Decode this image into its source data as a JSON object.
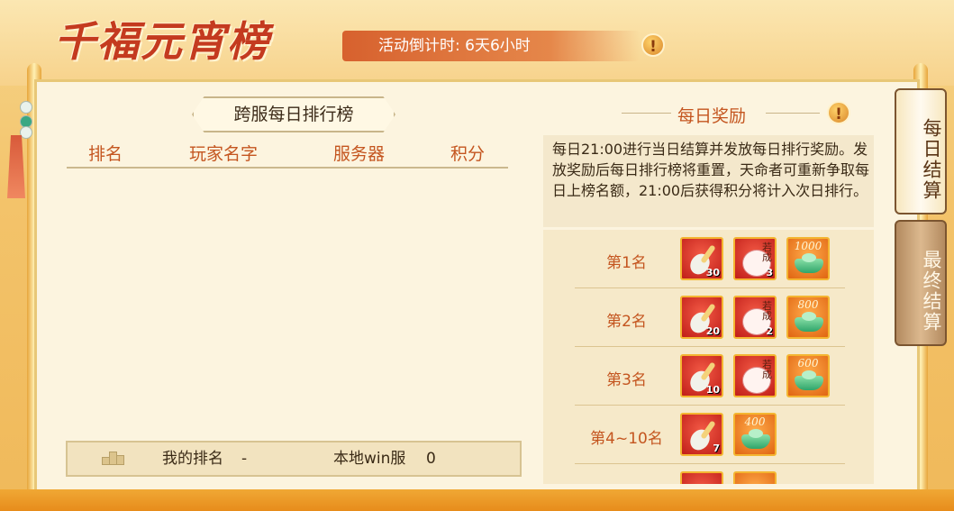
{
  "header": {
    "title": "千福元宵榜",
    "countdown": "活动倒计时: 6天6小时",
    "info_symbol": "!"
  },
  "leaderboard": {
    "tab_title": "跨服每日排行榜",
    "columns": [
      "排名",
      "玩家名字",
      "服务器",
      "积分"
    ],
    "my_rank_label": "我的排名",
    "my_rank_value": "-",
    "my_server": "本地win服",
    "my_score": "0"
  },
  "rewards": {
    "title": "每日奖励",
    "info_symbol": "!",
    "description": "每日21:00进行当日结算并发放每日排行奖励。发放奖励后每日排行榜将重置，天命者可重新争取每日上榜名额，21:00后获得积分将计入次日排行。",
    "rows": [
      {
        "label": "第1名",
        "items": [
          {
            "type": "spoon",
            "count": "30"
          },
          {
            "type": "bun",
            "count": "3",
            "text": "若成"
          },
          {
            "type": "ingot",
            "amount": "1000"
          }
        ]
      },
      {
        "label": "第2名",
        "items": [
          {
            "type": "spoon",
            "count": "20"
          },
          {
            "type": "bun",
            "count": "2",
            "text": "若成"
          },
          {
            "type": "ingot",
            "amount": "800"
          }
        ]
      },
      {
        "label": "第3名",
        "items": [
          {
            "type": "spoon",
            "count": "10"
          },
          {
            "type": "bun",
            "count": "",
            "text": "若成"
          },
          {
            "type": "ingot",
            "amount": "600"
          }
        ]
      },
      {
        "label": "第4~10名",
        "items": [
          {
            "type": "spoon",
            "count": "7"
          },
          {
            "type": "ingot",
            "amount": "400"
          }
        ]
      }
    ]
  },
  "side_tabs": {
    "daily": "每日结算",
    "final": "最终结算"
  },
  "colors": {
    "accent": "#c4551f",
    "gold": "#f4b531",
    "title_red": "#c43a1f"
  }
}
